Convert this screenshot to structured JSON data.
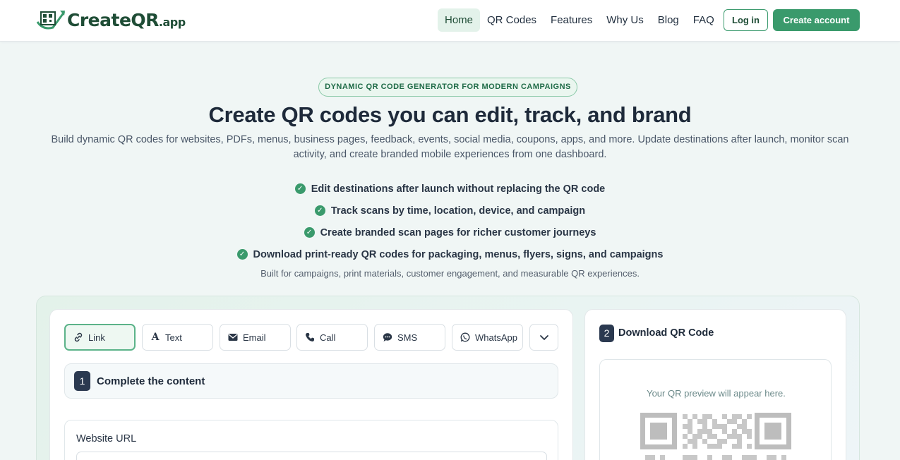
{
  "brand": {
    "name": "CreateQR",
    "suffix": ".app"
  },
  "nav": {
    "items": [
      {
        "label": "Home",
        "active": true
      },
      {
        "label": "QR Codes",
        "active": false
      },
      {
        "label": "Features",
        "active": false
      },
      {
        "label": "Why Us",
        "active": false
      },
      {
        "label": "Blog",
        "active": false
      },
      {
        "label": "FAQ",
        "active": false
      }
    ],
    "login_label": "Log in",
    "create_label": "Create account"
  },
  "hero": {
    "badge": "DYNAMIC QR CODE GENERATOR FOR MODERN CAMPAIGNS",
    "title": "Create QR codes you can edit, track, and brand",
    "subtitle": "Build dynamic QR codes for websites, PDFs, menus, business pages, feedback, events, social media, coupons, apps, and more. Update destinations after launch, monitor scan activity, and create branded mobile experiences from one dashboard.",
    "features": [
      "Edit destinations after launch without replacing the QR code",
      "Track scans by time, location, device, and campaign",
      "Create branded scan pages for richer customer journeys",
      "Download print-ready QR codes for packaging, menus, flyers, signs, and campaigns"
    ],
    "built_for": "Built for campaigns, print materials, customer engagement, and measurable QR experiences."
  },
  "generator": {
    "tabs": [
      {
        "label": "Link",
        "icon": "link-icon",
        "active": true
      },
      {
        "label": "Text",
        "icon": "text-icon",
        "active": false
      },
      {
        "label": "Email",
        "icon": "email-icon",
        "active": false
      },
      {
        "label": "Call",
        "icon": "phone-icon",
        "active": false
      },
      {
        "label": "SMS",
        "icon": "sms-icon",
        "active": false
      },
      {
        "label": "WhatsApp",
        "icon": "whatsapp-icon",
        "active": false
      }
    ],
    "step1": {
      "number": "1",
      "title": "Complete the content"
    },
    "url_label": "Website URL",
    "url_value": "",
    "step2": {
      "number": "2",
      "title": "Download QR Code"
    },
    "preview_text": "Your QR preview will appear here."
  },
  "colors": {
    "accent": "#3a9a6c",
    "dark": "#2b3950",
    "brand_text": "#1f4d36"
  }
}
